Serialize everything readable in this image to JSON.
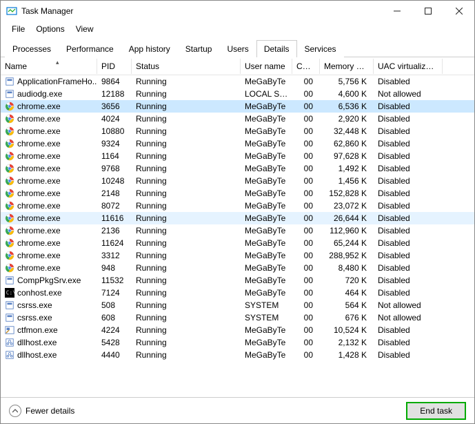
{
  "window": {
    "title": "Task Manager"
  },
  "menu": [
    "File",
    "Options",
    "View"
  ],
  "tabs": [
    "Processes",
    "Performance",
    "App history",
    "Startup",
    "Users",
    "Details",
    "Services"
  ],
  "active_tab": "Details",
  "columns": [
    "Name",
    "PID",
    "Status",
    "User name",
    "CPU",
    "Memory (a...",
    "UAC virtualizat..."
  ],
  "processes": [
    {
      "icon": "app",
      "name": "ApplicationFrameHo...",
      "pid": "9864",
      "status": "Running",
      "user": "MeGaByTe",
      "cpu": "00",
      "mem": "5,756 K",
      "uac": "Disabled",
      "state": ""
    },
    {
      "icon": "app",
      "name": "audiodg.exe",
      "pid": "12188",
      "status": "Running",
      "user": "LOCAL SE...",
      "cpu": "00",
      "mem": "4,600 K",
      "uac": "Not allowed",
      "state": ""
    },
    {
      "icon": "chrome",
      "name": "chrome.exe",
      "pid": "3656",
      "status": "Running",
      "user": "MeGaByTe",
      "cpu": "00",
      "mem": "6,536 K",
      "uac": "Disabled",
      "state": "selected"
    },
    {
      "icon": "chrome",
      "name": "chrome.exe",
      "pid": "4024",
      "status": "Running",
      "user": "MeGaByTe",
      "cpu": "00",
      "mem": "2,920 K",
      "uac": "Disabled",
      "state": ""
    },
    {
      "icon": "chrome",
      "name": "chrome.exe",
      "pid": "10880",
      "status": "Running",
      "user": "MeGaByTe",
      "cpu": "00",
      "mem": "32,448 K",
      "uac": "Disabled",
      "state": ""
    },
    {
      "icon": "chrome",
      "name": "chrome.exe",
      "pid": "9324",
      "status": "Running",
      "user": "MeGaByTe",
      "cpu": "00",
      "mem": "62,860 K",
      "uac": "Disabled",
      "state": ""
    },
    {
      "icon": "chrome",
      "name": "chrome.exe",
      "pid": "1164",
      "status": "Running",
      "user": "MeGaByTe",
      "cpu": "00",
      "mem": "97,628 K",
      "uac": "Disabled",
      "state": ""
    },
    {
      "icon": "chrome",
      "name": "chrome.exe",
      "pid": "9768",
      "status": "Running",
      "user": "MeGaByTe",
      "cpu": "00",
      "mem": "1,492 K",
      "uac": "Disabled",
      "state": ""
    },
    {
      "icon": "chrome",
      "name": "chrome.exe",
      "pid": "10248",
      "status": "Running",
      "user": "MeGaByTe",
      "cpu": "00",
      "mem": "1,456 K",
      "uac": "Disabled",
      "state": ""
    },
    {
      "icon": "chrome",
      "name": "chrome.exe",
      "pid": "2148",
      "status": "Running",
      "user": "MeGaByTe",
      "cpu": "00",
      "mem": "152,828 K",
      "uac": "Disabled",
      "state": ""
    },
    {
      "icon": "chrome",
      "name": "chrome.exe",
      "pid": "8072",
      "status": "Running",
      "user": "MeGaByTe",
      "cpu": "00",
      "mem": "23,072 K",
      "uac": "Disabled",
      "state": ""
    },
    {
      "icon": "chrome",
      "name": "chrome.exe",
      "pid": "11616",
      "status": "Running",
      "user": "MeGaByTe",
      "cpu": "00",
      "mem": "26,644 K",
      "uac": "Disabled",
      "state": "hover"
    },
    {
      "icon": "chrome",
      "name": "chrome.exe",
      "pid": "2136",
      "status": "Running",
      "user": "MeGaByTe",
      "cpu": "00",
      "mem": "112,960 K",
      "uac": "Disabled",
      "state": ""
    },
    {
      "icon": "chrome",
      "name": "chrome.exe",
      "pid": "11624",
      "status": "Running",
      "user": "MeGaByTe",
      "cpu": "00",
      "mem": "65,244 K",
      "uac": "Disabled",
      "state": ""
    },
    {
      "icon": "chrome",
      "name": "chrome.exe",
      "pid": "3312",
      "status": "Running",
      "user": "MeGaByTe",
      "cpu": "00",
      "mem": "288,952 K",
      "uac": "Disabled",
      "state": ""
    },
    {
      "icon": "chrome",
      "name": "chrome.exe",
      "pid": "948",
      "status": "Running",
      "user": "MeGaByTe",
      "cpu": "00",
      "mem": "8,480 K",
      "uac": "Disabled",
      "state": ""
    },
    {
      "icon": "app",
      "name": "CompPkgSrv.exe",
      "pid": "11532",
      "status": "Running",
      "user": "MeGaByTe",
      "cpu": "00",
      "mem": "720 K",
      "uac": "Disabled",
      "state": ""
    },
    {
      "icon": "console",
      "name": "conhost.exe",
      "pid": "7124",
      "status": "Running",
      "user": "MeGaByTe",
      "cpu": "00",
      "mem": "464 K",
      "uac": "Disabled",
      "state": ""
    },
    {
      "icon": "app",
      "name": "csrss.exe",
      "pid": "508",
      "status": "Running",
      "user": "SYSTEM",
      "cpu": "00",
      "mem": "564 K",
      "uac": "Not allowed",
      "state": ""
    },
    {
      "icon": "app",
      "name": "csrss.exe",
      "pid": "608",
      "status": "Running",
      "user": "SYSTEM",
      "cpu": "00",
      "mem": "676 K",
      "uac": "Not allowed",
      "state": ""
    },
    {
      "icon": "ctf",
      "name": "ctfmon.exe",
      "pid": "4224",
      "status": "Running",
      "user": "MeGaByTe",
      "cpu": "00",
      "mem": "10,524 K",
      "uac": "Disabled",
      "state": ""
    },
    {
      "icon": "dll",
      "name": "dllhost.exe",
      "pid": "5428",
      "status": "Running",
      "user": "MeGaByTe",
      "cpu": "00",
      "mem": "2,132 K",
      "uac": "Disabled",
      "state": ""
    },
    {
      "icon": "dll",
      "name": "dllhost.exe",
      "pid": "4440",
      "status": "Running",
      "user": "MeGaByTe",
      "cpu": "00",
      "mem": "1,428 K",
      "uac": "Disabled",
      "state": ""
    }
  ],
  "footer": {
    "fewer_label": "Fewer details",
    "end_task_label": "End task"
  }
}
